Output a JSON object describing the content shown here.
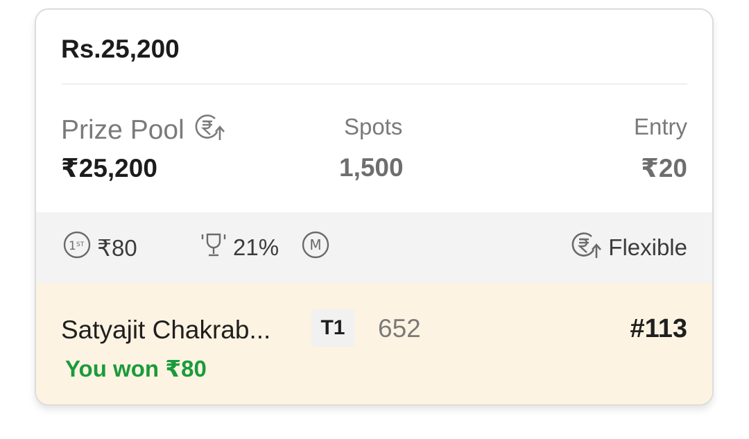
{
  "contest": {
    "title": "Rs.25,200"
  },
  "stats": {
    "prize_pool_label": "Prize Pool",
    "prize_pool_value": "₹25,200",
    "spots_label": "Spots",
    "spots_value": "1,500",
    "entry_label": "Entry",
    "entry_value": "₹20"
  },
  "meta": {
    "first_prize": "₹80",
    "winners_percent": "21%",
    "multi_entry_letter": "M",
    "flexible_label": "Flexible",
    "first_badge_text": "1ST"
  },
  "result": {
    "user_name": "Satyajit Chakrab...",
    "team_label": "T1",
    "points": "652",
    "rank": "#113",
    "won_text": "You won ₹80"
  },
  "colors": {
    "accent_green": "#1a9b3b",
    "result_bg": "#fdf3e2",
    "meta_bg": "#f3f3f3"
  },
  "icons": [
    "rupee-up-icon",
    "first-prize-icon",
    "trophy-icon",
    "multi-entry-icon"
  ]
}
